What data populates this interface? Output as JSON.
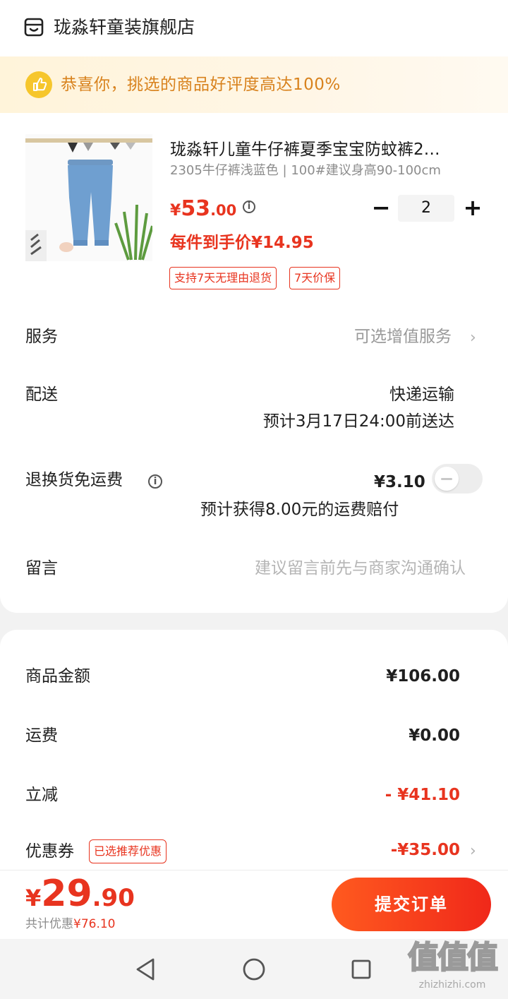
{
  "store": {
    "name": "珑淼轩童装旗舰店",
    "icon": "store-icon"
  },
  "banner": {
    "text": "恭喜你，挑选的商品好评度高达100%",
    "icon": "thumbs-up-icon"
  },
  "product": {
    "title": "珑淼轩儿童牛仔裤夏季宝宝防蚊裤2…",
    "spec": "2305牛仔裤浅蓝色 | 100#建议身高90-100cm",
    "price_currency": "¥",
    "price_int": "53",
    "price_dec": ".00",
    "quantity": "2",
    "minus": "−",
    "plus": "+",
    "unit_price": "每件到手价¥14.95",
    "tags": [
      "支持7天无理由退货",
      "7天价保"
    ]
  },
  "service": {
    "label": "服务",
    "value": "可选增值服务",
    "chevron": "›"
  },
  "delivery": {
    "label": "配送",
    "method": "快递运输",
    "eta": "预计3月17日24:00前送达"
  },
  "return_insurance": {
    "label": "退换货免运费",
    "price": "¥3.10",
    "note": "预计获得8.00元的运费赔付",
    "enabled": false
  },
  "message": {
    "label": "留言",
    "placeholder": "建议留言前先与商家沟通确认"
  },
  "summary": {
    "goods_label": "商品金额",
    "goods_value": "¥106.00",
    "shipping_label": "运费",
    "shipping_value": "¥0.00",
    "discount_label": "立减",
    "discount_value": "- ¥41.10",
    "coupon_label": "优惠券",
    "coupon_tag": "已选推荐优惠",
    "coupon_value": "-¥35.00",
    "coupon_chevron": "›"
  },
  "footer": {
    "total_currency": "¥",
    "total_int": "29",
    "total_dec": ".90",
    "saving_label": "共计优惠",
    "saving_value": "¥76.10",
    "submit_label": "提交订单"
  },
  "watermark": {
    "text": "值值值",
    "site": "zhizhizhi.com"
  },
  "colors": {
    "accent": "#e8341f",
    "banner_text": "#d8821d",
    "submit_start": "#ff5a1f",
    "submit_end": "#f0281a"
  }
}
